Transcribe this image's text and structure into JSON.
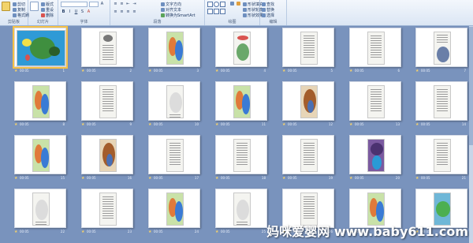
{
  "ribbon": {
    "groups": [
      {
        "id": "clipboard",
        "label": "剪贴板",
        "buttons": [
          "粘贴",
          "剪切",
          "复制",
          "格式刷"
        ]
      },
      {
        "id": "slides",
        "label": "幻灯片",
        "buttons": [
          "新建",
          "版式",
          "重设",
          "删除"
        ]
      },
      {
        "id": "font",
        "label": "字体",
        "font_name": "",
        "font_size": "",
        "buttons": [
          "B",
          "I",
          "U",
          "S",
          "A"
        ]
      },
      {
        "id": "paragraph",
        "label": "段落",
        "buttons": [
          "文字方向",
          "对齐文本",
          "转换为SmartArt"
        ]
      },
      {
        "id": "drawing",
        "label": "绘图",
        "buttons": [
          "排列",
          "快速样式",
          "形状填充",
          "形状轮廓",
          "形状效果"
        ]
      },
      {
        "id": "editing",
        "label": "编辑",
        "buttons": [
          "查找",
          "替换",
          "选择"
        ]
      }
    ]
  },
  "slides": [
    {
      "n": "1",
      "dur": "00:05",
      "kind": "title"
    },
    {
      "n": "2",
      "dur": "00:05",
      "kind": "photo-text"
    },
    {
      "n": "3",
      "dur": "00:05",
      "kind": "art"
    },
    {
      "n": "4",
      "dur": "00:05",
      "kind": "heading-art"
    },
    {
      "n": "5",
      "dur": "00:05",
      "kind": "text"
    },
    {
      "n": "6",
      "dur": "00:05",
      "kind": "text"
    },
    {
      "n": "7",
      "dur": "00:05",
      "kind": "text-art"
    },
    {
      "n": "8",
      "dur": "00:05",
      "kind": "art"
    },
    {
      "n": "9",
      "dur": "00:05",
      "kind": "text"
    },
    {
      "n": "10",
      "dur": "00:05",
      "kind": "sketch"
    },
    {
      "n": "11",
      "dur": "00:05",
      "kind": "art"
    },
    {
      "n": "12",
      "dur": "00:05",
      "kind": "art2"
    },
    {
      "n": "13",
      "dur": "00:05",
      "kind": "text"
    },
    {
      "n": "14",
      "dur": "00:05",
      "kind": "text"
    },
    {
      "n": "15",
      "dur": "00:05",
      "kind": "art"
    },
    {
      "n": "16",
      "dur": "00:05",
      "kind": "art2"
    },
    {
      "n": "17",
      "dur": "00:05",
      "kind": "text"
    },
    {
      "n": "18",
      "dur": "00:05",
      "kind": "text"
    },
    {
      "n": "19",
      "dur": "00:05",
      "kind": "text"
    },
    {
      "n": "20",
      "dur": "00:05",
      "kind": "art3"
    },
    {
      "n": "21",
      "dur": "00:05",
      "kind": "text"
    },
    {
      "n": "22",
      "dur": "00:05",
      "kind": "sketch"
    },
    {
      "n": "23",
      "dur": "00:05",
      "kind": "text"
    },
    {
      "n": "24",
      "dur": "00:05",
      "kind": "art"
    },
    {
      "n": "25",
      "dur": "00:05",
      "kind": "sketch"
    },
    {
      "n": "26",
      "dur": "00:05",
      "kind": "text"
    },
    {
      "n": "27",
      "dur": "00:05",
      "kind": "art"
    },
    {
      "n": "28",
      "dur": "00:05",
      "kind": "art4"
    }
  ],
  "watermark": "妈咪爱婴网 www.baby611.com",
  "colors": {
    "sorter_bg": "#7993bd",
    "selected": "#f5c045",
    "ribbon": "#dbe6f4"
  }
}
